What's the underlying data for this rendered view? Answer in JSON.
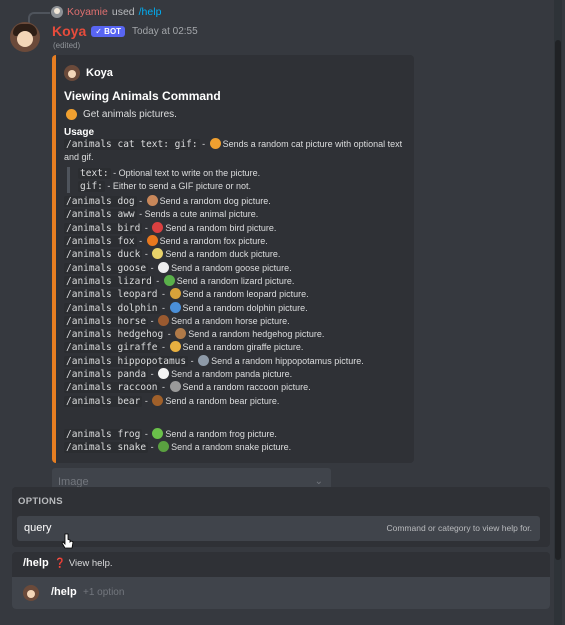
{
  "reply": {
    "user": "Koyamie",
    "verb": "used",
    "command": "/help"
  },
  "message": {
    "author": "Koya",
    "badge": "✓ BOT",
    "timestamp": "Today at 02:55",
    "edited": "(edited)"
  },
  "embed": {
    "author": "Koya",
    "title": "Viewing Animals Command",
    "description": "Get animals pictures.",
    "usage_heading": "Usage",
    "lines": [
      {
        "code": "/animals cat text: gif:",
        "sep": " - ",
        "emoji": "#f0a030",
        "text": "Sends a random cat picture with optional text and gif."
      },
      {
        "code": "text:",
        "sep": " - ",
        "emoji": "",
        "text": "Optional text to write on the picture.",
        "sub": true
      },
      {
        "code": "gif:",
        "sep": " - ",
        "emoji": "",
        "text": "Either to send a GIF picture or not.",
        "sub": true
      },
      {
        "code": "/animals dog",
        "sep": " - ",
        "emoji": "#c8875a",
        "text": "Send a random dog picture."
      },
      {
        "code": "/animals aww",
        "sep": " - ",
        "emoji": "",
        "text": "Sends a cute animal picture."
      },
      {
        "code": "/animals bird",
        "sep": " - ",
        "emoji": "#d94040",
        "text": "Send a random bird picture."
      },
      {
        "code": "/animals fox",
        "sep": " - ",
        "emoji": "#e8781e",
        "text": "Send a random fox picture."
      },
      {
        "code": "/animals duck",
        "sep": " - ",
        "emoji": "#e8d26a",
        "text": "Send a random duck picture."
      },
      {
        "code": "/animals goose",
        "sep": " - ",
        "emoji": "#eeeeee",
        "text": "Send a random goose picture."
      },
      {
        "code": "/animals lizard",
        "sep": " - ",
        "emoji": "#5ab04a",
        "text": "Send a random lizard picture."
      },
      {
        "code": "/animals leopard",
        "sep": " - ",
        "emoji": "#d8a33a",
        "text": "Send a random leopard picture."
      },
      {
        "code": "/animals dolphin",
        "sep": " - ",
        "emoji": "#4a8fd8",
        "text": "Send a random dolphin picture."
      },
      {
        "code": "/animals horse",
        "sep": " - ",
        "emoji": "#9a5a30",
        "text": "Send a random horse picture."
      },
      {
        "code": "/animals hedgehog",
        "sep": " - ",
        "emoji": "#b07a48",
        "text": "Send a random hedgehog picture."
      },
      {
        "code": "/animals giraffe",
        "sep": " - ",
        "emoji": "#e8b040",
        "text": "Send a random giraffe picture."
      },
      {
        "code": "/animals hippopotamus",
        "sep": " - ",
        "emoji": "#8e9aa8",
        "text": "Send a random hippopotamus picture."
      },
      {
        "code": "/animals panda",
        "sep": " - ",
        "emoji": "#f4f4f4",
        "text": "Send a random panda picture."
      },
      {
        "code": "/animals raccoon",
        "sep": " - ",
        "emoji": "#9a9a9a",
        "text": "Send a random raccoon picture."
      },
      {
        "code": "/animals bear",
        "sep": " - ",
        "emoji": "#a0602a",
        "text": "Send a random bear picture."
      }
    ],
    "extra_lines": [
      {
        "code": "/animals frog",
        "sep": " - ",
        "emoji": "#6ac04a",
        "text": "Send a random frog picture."
      },
      {
        "code": "/animals snake",
        "sep": " - ",
        "emoji": "#5aa040",
        "text": "Send a random snake picture."
      }
    ]
  },
  "image_field": {
    "placeholder": "Image"
  },
  "options": {
    "heading": "OPTIONS",
    "query_name": "query",
    "query_desc": "Command or category to view help for."
  },
  "help_suggestion": {
    "command": "/help",
    "icon": "❓",
    "desc": "View help."
  },
  "chat_input": {
    "command": "/help",
    "option_hint": "+1 option"
  },
  "colors": {
    "accent": "#e67e22",
    "bot_badge": "#5865f2",
    "bot_name": "#e74c3c"
  }
}
